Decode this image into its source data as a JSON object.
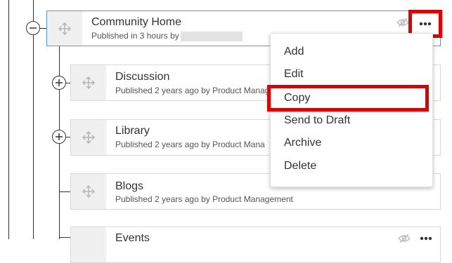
{
  "nodes": [
    {
      "title": "Community Home",
      "subtitle": "Published in 3 hours by"
    },
    {
      "title": "Discussion",
      "subtitle": "Published 2 years ago by Product Manag"
    },
    {
      "title": "Library",
      "subtitle": "Published 2 years ago by Product Mana"
    },
    {
      "title": "Blogs",
      "subtitle": "Published 2 years ago by Product Management"
    },
    {
      "title": "Events",
      "subtitle": ""
    }
  ],
  "menu": {
    "items": [
      "Add",
      "Edit",
      "Copy",
      "Send to Draft",
      "Archive",
      "Delete"
    ]
  },
  "icons": {
    "drag": "move-arrows-icon",
    "hidden": "eye-slash-icon",
    "more": "ellipsis-icon",
    "expand": "plus-circle-icon",
    "collapse": "minus-circle-icon"
  },
  "colors": {
    "highlight": "#e00000",
    "active_border": "#5b9bd5",
    "handle_bg": "#f0f0f0"
  }
}
